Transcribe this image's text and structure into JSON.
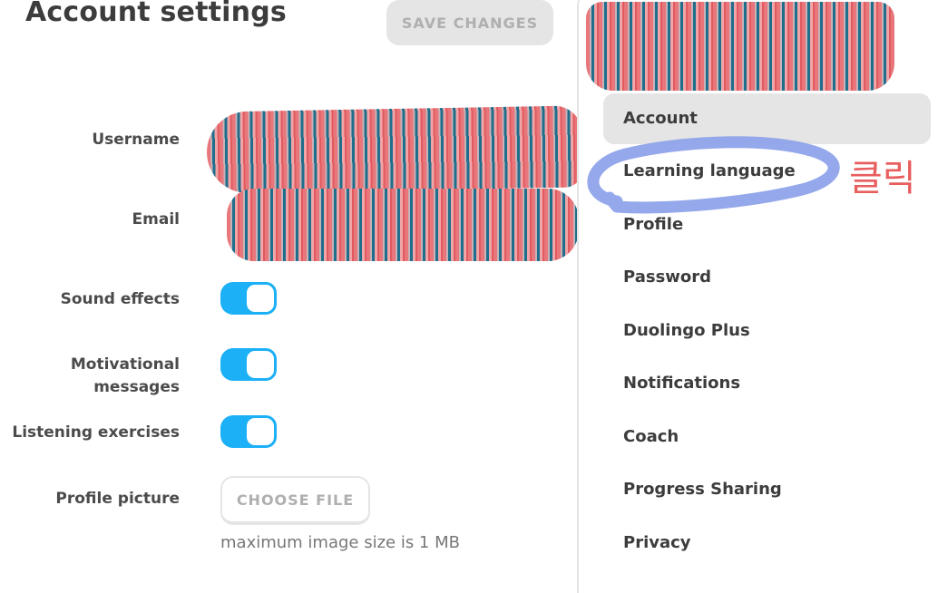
{
  "header": {
    "title": "Account settings",
    "save_label": "SAVE CHANGES"
  },
  "form": {
    "username_label": "Username",
    "email_label": "Email",
    "sound_effects_label": "Sound effects",
    "motivational_label_line1": "Motivational",
    "motivational_label_line2": "messages",
    "listening_label": "Listening exercises",
    "profile_picture_label": "Profile picture",
    "choose_file_label": "CHOOSE FILE",
    "image_size_hint": "maximum image size is 1 MB",
    "toggles": {
      "sound_effects": true,
      "motivational_messages": true,
      "listening_exercises": true
    }
  },
  "sidebar": {
    "items": [
      {
        "label": "Account",
        "active": true
      },
      {
        "label": "Learning language"
      },
      {
        "label": "Profile"
      },
      {
        "label": "Password"
      },
      {
        "label": "Duolingo Plus"
      },
      {
        "label": "Notifications"
      },
      {
        "label": "Coach"
      },
      {
        "label": "Progress Sharing"
      },
      {
        "label": "Privacy"
      }
    ]
  },
  "annotation": {
    "text": "클릭",
    "color": "#e85d5d",
    "circle_color": "#8ea3ea"
  },
  "colors": {
    "accent": "#1cb0f6",
    "text": "#3c3c3c",
    "muted": "#afafaf"
  }
}
